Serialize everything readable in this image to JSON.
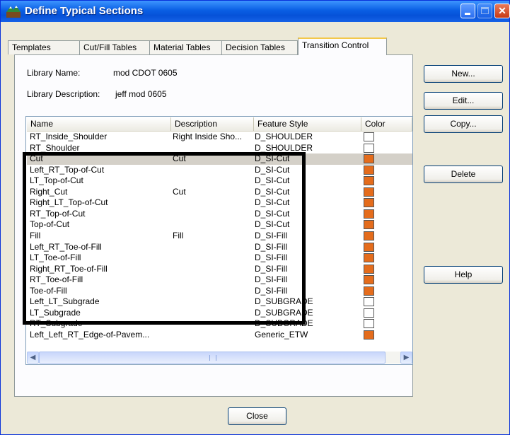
{
  "window": {
    "title": "Define Typical Sections"
  },
  "tabs": [
    {
      "label": "Templates"
    },
    {
      "label": "Cut/Fill Tables"
    },
    {
      "label": "Material Tables"
    },
    {
      "label": "Decision Tables"
    },
    {
      "label": "Transition Control"
    }
  ],
  "active_tab": "Transition Control",
  "library": {
    "name_label": "Library Name:",
    "name_value": "mod CDOT 0605",
    "desc_label": "Library Description:",
    "desc_value": "jeff mod 0605"
  },
  "buttons": {
    "new": "New...",
    "edit": "Edit...",
    "copy": "Copy...",
    "delete": "Delete",
    "help": "Help",
    "close": "Close"
  },
  "list": {
    "columns": [
      "Name",
      "Description",
      "Feature Style",
      "Color"
    ],
    "rows": [
      {
        "name": "RT_Inside_Shoulder",
        "desc": "Right Inside Sho...",
        "style": "D_SHOULDER",
        "color": "#ffffff"
      },
      {
        "name": "RT_Shoulder",
        "desc": "",
        "style": "D_SHOULDER",
        "color": "#ffffff"
      },
      {
        "name": "Cut",
        "desc": "Cut",
        "style": "D_SI-Cut",
        "color": "#e46c1c",
        "selected": true
      },
      {
        "name": "Left_RT_Top-of-Cut",
        "desc": "",
        "style": "D_SI-Cut",
        "color": "#e46c1c"
      },
      {
        "name": "LT_Top-of-Cut",
        "desc": "",
        "style": "D_SI-Cut",
        "color": "#e46c1c"
      },
      {
        "name": "Right_Cut",
        "desc": "Cut",
        "style": "D_SI-Cut",
        "color": "#e46c1c"
      },
      {
        "name": "Right_LT_Top-of-Cut",
        "desc": "",
        "style": "D_SI-Cut",
        "color": "#e46c1c"
      },
      {
        "name": "RT_Top-of-Cut",
        "desc": "",
        "style": "D_SI-Cut",
        "color": "#e46c1c"
      },
      {
        "name": "Top-of-Cut",
        "desc": "",
        "style": "D_SI-Cut",
        "color": "#e46c1c"
      },
      {
        "name": "Fill",
        "desc": "Fill",
        "style": "D_SI-Fill",
        "color": "#e46c1c"
      },
      {
        "name": "Left_RT_Toe-of-Fill",
        "desc": "",
        "style": "D_SI-Fill",
        "color": "#e46c1c"
      },
      {
        "name": "LT_Toe-of-Fill",
        "desc": "",
        "style": "D_SI-Fill",
        "color": "#e46c1c"
      },
      {
        "name": "Right_RT_Toe-of-Fill",
        "desc": "",
        "style": "D_SI-Fill",
        "color": "#e46c1c"
      },
      {
        "name": "RT_Toe-of-Fill",
        "desc": "",
        "style": "D_SI-Fill",
        "color": "#e46c1c"
      },
      {
        "name": "Toe-of-Fill",
        "desc": "",
        "style": "D_SI-Fill",
        "color": "#e46c1c"
      },
      {
        "name": "Left_LT_Subgrade",
        "desc": "",
        "style": "D_SUBGRADE",
        "color": "#ffffff"
      },
      {
        "name": "LT_Subgrade",
        "desc": "",
        "style": "D_SUBGRADE",
        "color": "#ffffff"
      },
      {
        "name": "RT_Subgrade",
        "desc": "",
        "style": "D_SUBGRADE",
        "color": "#ffffff"
      },
      {
        "name": "Left_Left_RT_Edge-of-Pavem...",
        "desc": "",
        "style": "Generic_ETW",
        "color": "#e46c1c"
      }
    ]
  },
  "icons": {
    "scroll_up": "▲",
    "scroll_down": "▼",
    "scroll_left": "◀",
    "scroll_right": "▶",
    "min": "minimize-icon",
    "max": "maximize-icon",
    "close": "✕"
  },
  "colors": {
    "cut_fill_swatch": "#e46c1c",
    "titlebar": "#0a5fe4",
    "highlight_box": "#000000"
  }
}
